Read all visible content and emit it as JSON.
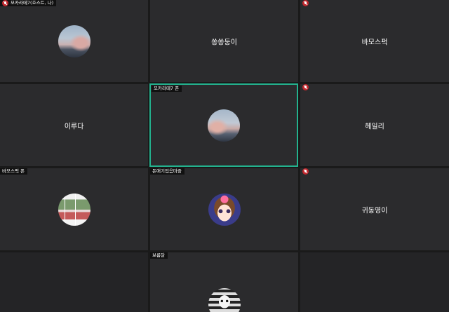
{
  "tiles": [
    {
      "id": "host",
      "label": "모카라떼7(호스트, 나)",
      "muted": true,
      "display": "avatar-sky"
    },
    {
      "id": "ssongssong",
      "label": "",
      "muted": false,
      "display_name": "쏭쏭둥이"
    },
    {
      "id": "bamoseupeok",
      "label": "",
      "muted": true,
      "display_name": "바모스퍽"
    },
    {
      "id": "ireuda",
      "label": "",
      "muted": false,
      "display_name": "이루다"
    },
    {
      "id": "mocha-speaking",
      "label": "모카라떼7 폰",
      "muted": false,
      "active": true,
      "display": "avatar-sky"
    },
    {
      "id": "hayeli",
      "label": "",
      "muted": true,
      "display_name": "헤일리"
    },
    {
      "id": "bamoseupeok-phone",
      "label": "바모스퍽 폰",
      "muted": false,
      "display": "avatar-photos"
    },
    {
      "id": "donegi",
      "label": "돈애기업음마즐",
      "muted": false,
      "display": "avatar-girl"
    },
    {
      "id": "gwidong",
      "label": "",
      "muted": true,
      "display_name": "귀동영이"
    },
    {
      "id": "boreumdal",
      "label": "보름달",
      "muted": false,
      "display": "avatar-dog"
    }
  ],
  "colors": {
    "active_border": "#23b28e",
    "tile_bg": "#2b2b2d",
    "muted_icon": "#c1272d"
  }
}
